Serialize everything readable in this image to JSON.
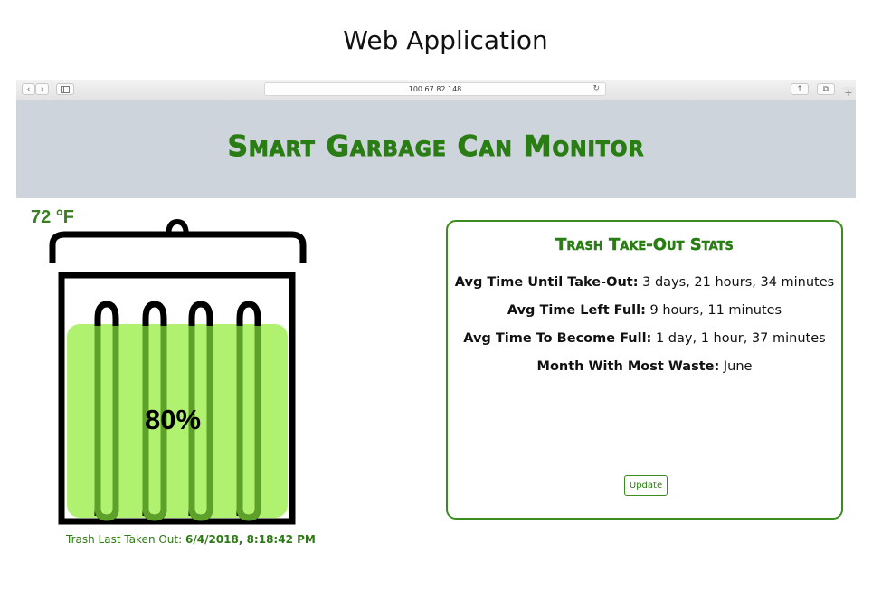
{
  "caption": "Web Application",
  "browser": {
    "back_icon": "chevron-left-icon",
    "forward_icon": "chevron-right-icon",
    "sidebar_icon": "sidebar-icon",
    "url": "100.67.82.148",
    "reload_icon": "reload-icon",
    "share_icon": "share-icon",
    "tabs_icon": "tabs-icon",
    "new_tab_glyph": "+"
  },
  "header": {
    "title": "Smart Garbage Can Monitor",
    "background": "#ced4dc",
    "title_color": "#2a7d14"
  },
  "temperature": "72 °F",
  "can": {
    "fill_percent": 80,
    "fill_label": "80%",
    "fill_color": "#b0f26f",
    "bag_color": "#5ea12a"
  },
  "last_taken": {
    "label": "Trash Last Taken Out: ",
    "value": "6/4/2018, 8:18:42 PM"
  },
  "stats": {
    "title": "Trash Take-Out Stats",
    "rows": [
      {
        "label": "Avg Time Until Take-Out:",
        "value": " 3 days, 21 hours, 34 minutes"
      },
      {
        "label": "Avg Time Left Full:",
        "value": " 9 hours, 11 minutes"
      },
      {
        "label": "Avg Time To Become Full:",
        "value": " 1 day, 1 hour, 37 minutes"
      },
      {
        "label": "Month With Most Waste:",
        "value": " June"
      }
    ],
    "update_label": "Update",
    "border_color": "#3a8c1e"
  }
}
